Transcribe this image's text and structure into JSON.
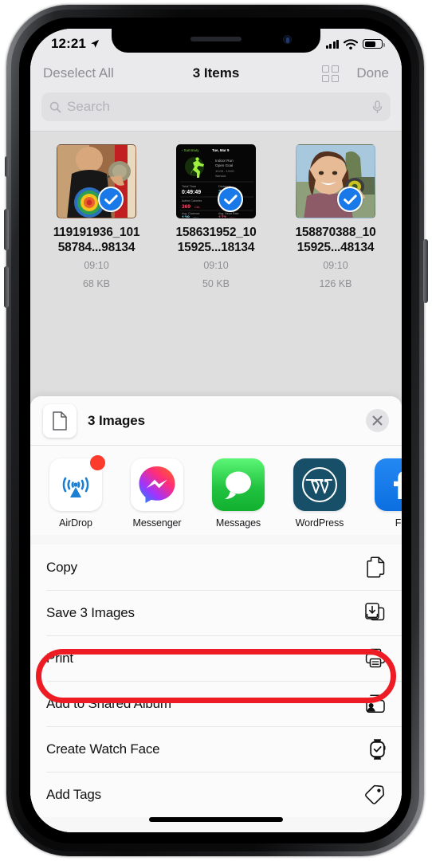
{
  "status_bar": {
    "time": "12:21",
    "location_icon": "location-arrow-icon",
    "signal_icon": "cellular-signal-icon",
    "wifi_icon": "wifi-icon",
    "battery_icon": "battery-icon",
    "battery_level_pct": 58
  },
  "files_toolbar": {
    "deselect_all": "Deselect All",
    "title": "3 Items",
    "grid_icon": "grid-view-icon",
    "done": "Done"
  },
  "search": {
    "placeholder": "Search",
    "value": "",
    "search_icon": "search-icon",
    "mic_icon": "microphone-icon"
  },
  "files": [
    {
      "name_line1": "119191936_101",
      "name_line2": "58784...98134",
      "time": "09:10",
      "size": "68 KB",
      "selected": true,
      "thumb_kind": "photo-person-medal"
    },
    {
      "name_line1": "158631952_10",
      "name_line2": "15925...18134",
      "time": "09:10",
      "size": "50 KB",
      "selected": true,
      "thumb_kind": "watch-workout-summary",
      "watch": {
        "back_label": "Summary",
        "date": "Tue, Mar 9",
        "workout": "Indoor Run",
        "goal": "Open Goal",
        "time_range": "10:09 - 13:00",
        "label_total_time": "Total Time",
        "value_total_time": "0:49:49",
        "label_distance": "Distance",
        "value_distance": "3.10",
        "unit_distance": "MI",
        "label_active_cal": "Active Calories",
        "value_active_cal": "369",
        "unit_active_cal": "CAL",
        "label_total_cal": "Total Calories",
        "label_avg_cadence": "Avg. Cadence",
        "value_avg_cadence": "128",
        "unit_avg_cadence": "SPM",
        "label_avg_hr": "Avg. Heart Rate",
        "value_avg_hr": "173",
        "unit_avg_hr": "BPM"
      }
    },
    {
      "name_line1": "158870388_10",
      "name_line2": "15925...48134",
      "time": "09:10",
      "size": "126 KB",
      "selected": true,
      "thumb_kind": "photo-selfie-medal"
    }
  ],
  "share_sheet": {
    "doc_icon": "document-icon",
    "title": "3 Images",
    "close_icon": "close-icon",
    "apps": [
      {
        "label": "AirDrop",
        "icon": "airdrop-icon",
        "badge": true
      },
      {
        "label": "Messenger",
        "icon": "messenger-icon",
        "badge": false
      },
      {
        "label": "Messages",
        "icon": "messages-icon",
        "badge": false
      },
      {
        "label": "WordPress",
        "icon": "wordpress-icon",
        "badge": false
      },
      {
        "label": "Fa",
        "icon": "facebook-icon",
        "badge": false
      }
    ],
    "actions": [
      {
        "label": "Copy",
        "icon": "copy-icon",
        "highlighted": false
      },
      {
        "label": "Save 3 Images",
        "icon": "save-images-icon",
        "highlighted": true
      },
      {
        "label": "Print",
        "icon": "printer-icon",
        "highlighted": false
      },
      {
        "label": "Add to Shared Album",
        "icon": "shared-album-icon",
        "highlighted": false
      },
      {
        "label": "Create Watch Face",
        "icon": "watch-face-icon",
        "highlighted": false
      },
      {
        "label": "Add Tags",
        "icon": "tag-icon",
        "highlighted": false
      }
    ]
  },
  "annotation": {
    "color": "#ed1c24",
    "target": "Save 3 Images"
  },
  "home_indicator": "home-indicator"
}
